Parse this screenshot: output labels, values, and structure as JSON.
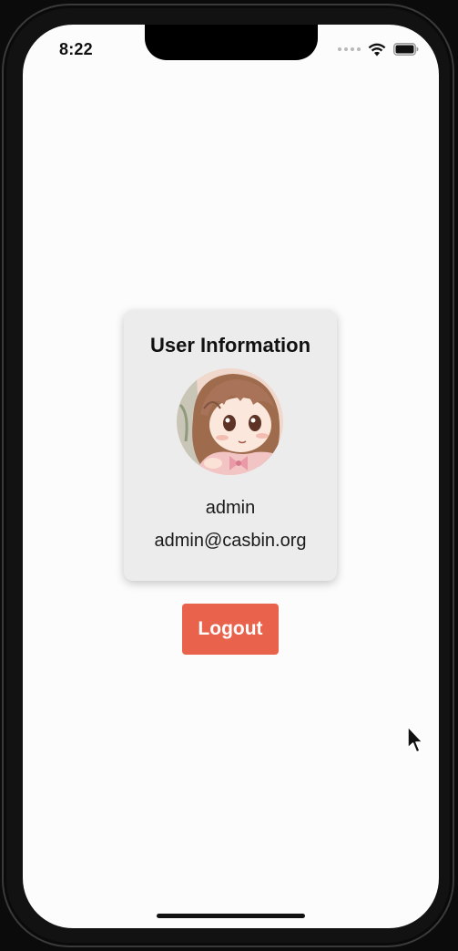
{
  "status_bar": {
    "time": "8:22",
    "icons": [
      "signal-dots-icon",
      "wifi-icon",
      "battery-icon"
    ]
  },
  "card": {
    "title": "User Information",
    "avatar": "anime-avatar-image",
    "username": "admin",
    "email": "admin@casbin.org"
  },
  "logout_button": {
    "label": "Logout",
    "color": "#e9634c"
  },
  "colors": {
    "screen_bg": "#fcfcfc",
    "card_bg": "#ececec"
  }
}
